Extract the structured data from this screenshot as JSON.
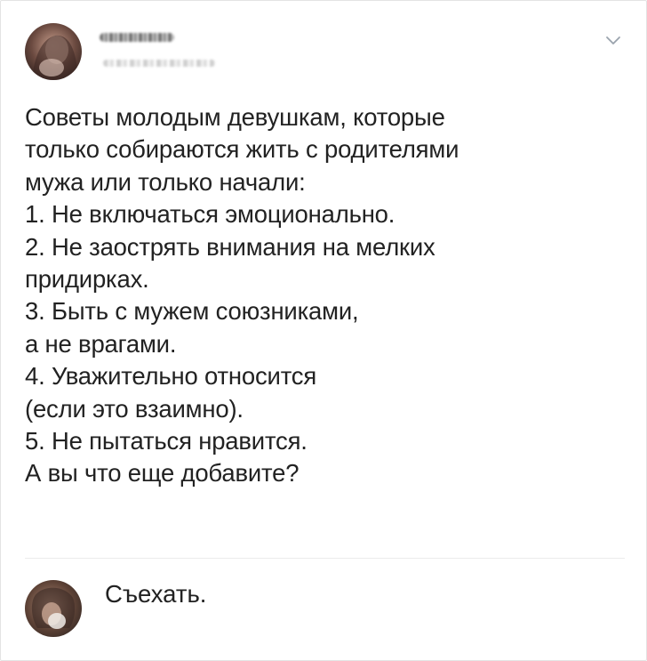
{
  "post": {
    "avatar_icon": "user-avatar-icon",
    "menu_icon": "chevron-down-icon",
    "lines": [
      "Советы молодым девушкам, которые",
      "только собираются жить с родителями",
      "мужа или только начали:",
      "1. Не включаться эмоционально.",
      "2. Не заострять внимания на мелких",
      "придирках.",
      "3. Быть с мужем союзниками,",
      "а не врагами.",
      "4. Уважительно относится",
      "(если это взаимно).",
      "5. Не пытаться нравится.",
      "А вы что еще добавите?"
    ]
  },
  "reply": {
    "avatar_icon": "user-avatar-icon",
    "text": "Съехать."
  },
  "colors": {
    "background": "#ffffff",
    "text": "#222222",
    "border": "#e3e3e3",
    "chevron": "#9aa3ad"
  }
}
